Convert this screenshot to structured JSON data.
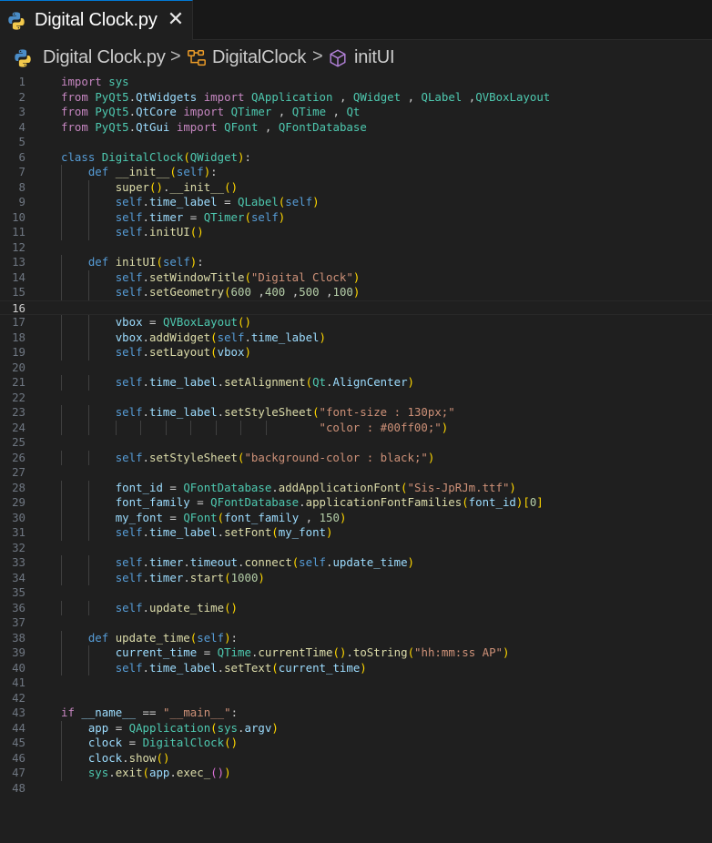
{
  "tab": {
    "title": "Digital Clock.py",
    "close_glyph": "✕",
    "icon": "python-icon"
  },
  "breadcrumb": {
    "file": "Digital Clock.py",
    "class": "DigitalClock",
    "method": "initUI",
    "separator": ">"
  },
  "editor": {
    "active_line": 16,
    "lines": [
      {
        "n": "1",
        "code": "import sys"
      },
      {
        "n": "2",
        "code": "from PyQt5.QtWidgets import QApplication , QWidget , QLabel ,QVBoxLayout"
      },
      {
        "n": "3",
        "code": "from PyQt5.QtCore import QTimer , QTime , Qt"
      },
      {
        "n": "4",
        "code": "from PyQt5.QtGui import QFont , QFontDatabase"
      },
      {
        "n": "5",
        "code": ""
      },
      {
        "n": "6",
        "code": "class DigitalClock(QWidget):"
      },
      {
        "n": "7",
        "code": "    def __init__(self):"
      },
      {
        "n": "8",
        "code": "        super().__init__()"
      },
      {
        "n": "9",
        "code": "        self.time_label = QLabel(self)"
      },
      {
        "n": "10",
        "code": "        self.timer = QTimer(self)"
      },
      {
        "n": "11",
        "code": "        self.initUI()"
      },
      {
        "n": "12",
        "code": ""
      },
      {
        "n": "13",
        "code": "    def initUI(self):"
      },
      {
        "n": "14",
        "code": "        self.setWindowTitle(\"Digital Clock\")"
      },
      {
        "n": "15",
        "code": "        self.setGeometry(600 ,400 ,500 ,100)"
      },
      {
        "n": "16",
        "code": ""
      },
      {
        "n": "17",
        "code": "        vbox = QVBoxLayout()"
      },
      {
        "n": "18",
        "code": "        vbox.addWidget(self.time_label)"
      },
      {
        "n": "19",
        "code": "        self.setLayout(vbox)"
      },
      {
        "n": "20",
        "code": ""
      },
      {
        "n": "21",
        "code": "        self.time_label.setAlignment(Qt.AlignCenter)"
      },
      {
        "n": "22",
        "code": ""
      },
      {
        "n": "23",
        "code": "        self.time_label.setStyleSheet(\"font-size : 130px;\""
      },
      {
        "n": "24",
        "code": "                                      \"color : #00ff00;\")"
      },
      {
        "n": "25",
        "code": ""
      },
      {
        "n": "26",
        "code": "        self.setStyleSheet(\"background-color : black;\")"
      },
      {
        "n": "27",
        "code": ""
      },
      {
        "n": "28",
        "code": "        font_id = QFontDatabase.addApplicationFont(\"Sis-JpRJm.ttf\")"
      },
      {
        "n": "29",
        "code": "        font_family = QFontDatabase.applicationFontFamilies(font_id)[0]"
      },
      {
        "n": "30",
        "code": "        my_font = QFont(font_family , 150)"
      },
      {
        "n": "31",
        "code": "        self.time_label.setFont(my_font)"
      },
      {
        "n": "32",
        "code": ""
      },
      {
        "n": "33",
        "code": "        self.timer.timeout.connect(self.update_time)"
      },
      {
        "n": "34",
        "code": "        self.timer.start(1000)"
      },
      {
        "n": "35",
        "code": ""
      },
      {
        "n": "36",
        "code": "        self.update_time()"
      },
      {
        "n": "37",
        "code": ""
      },
      {
        "n": "38",
        "code": "    def update_time(self):"
      },
      {
        "n": "39",
        "code": "        current_time = QTime.currentTime().toString(\"hh:mm:ss AP\")"
      },
      {
        "n": "40",
        "code": "        self.time_label.setText(current_time)"
      },
      {
        "n": "41",
        "code": ""
      },
      {
        "n": "42",
        "code": ""
      },
      {
        "n": "43",
        "code": "if __name__ == \"__main__\":"
      },
      {
        "n": "44",
        "code": "    app = QApplication(sys.argv)"
      },
      {
        "n": "45",
        "code": "    clock = DigitalClock()"
      },
      {
        "n": "46",
        "code": "    clock.show()"
      },
      {
        "n": "47",
        "code": "    sys.exit(app.exec_())"
      },
      {
        "n": "48",
        "code": ""
      }
    ]
  },
  "colors": {
    "background": "#1f1f1f",
    "keyword": "#c586c0",
    "storage": "#569cd6",
    "class": "#4ec9b0",
    "function": "#dcdcaa",
    "variable": "#9cdcfe",
    "string": "#ce9178",
    "number": "#b5cea8",
    "line_number": "#6e7681"
  }
}
